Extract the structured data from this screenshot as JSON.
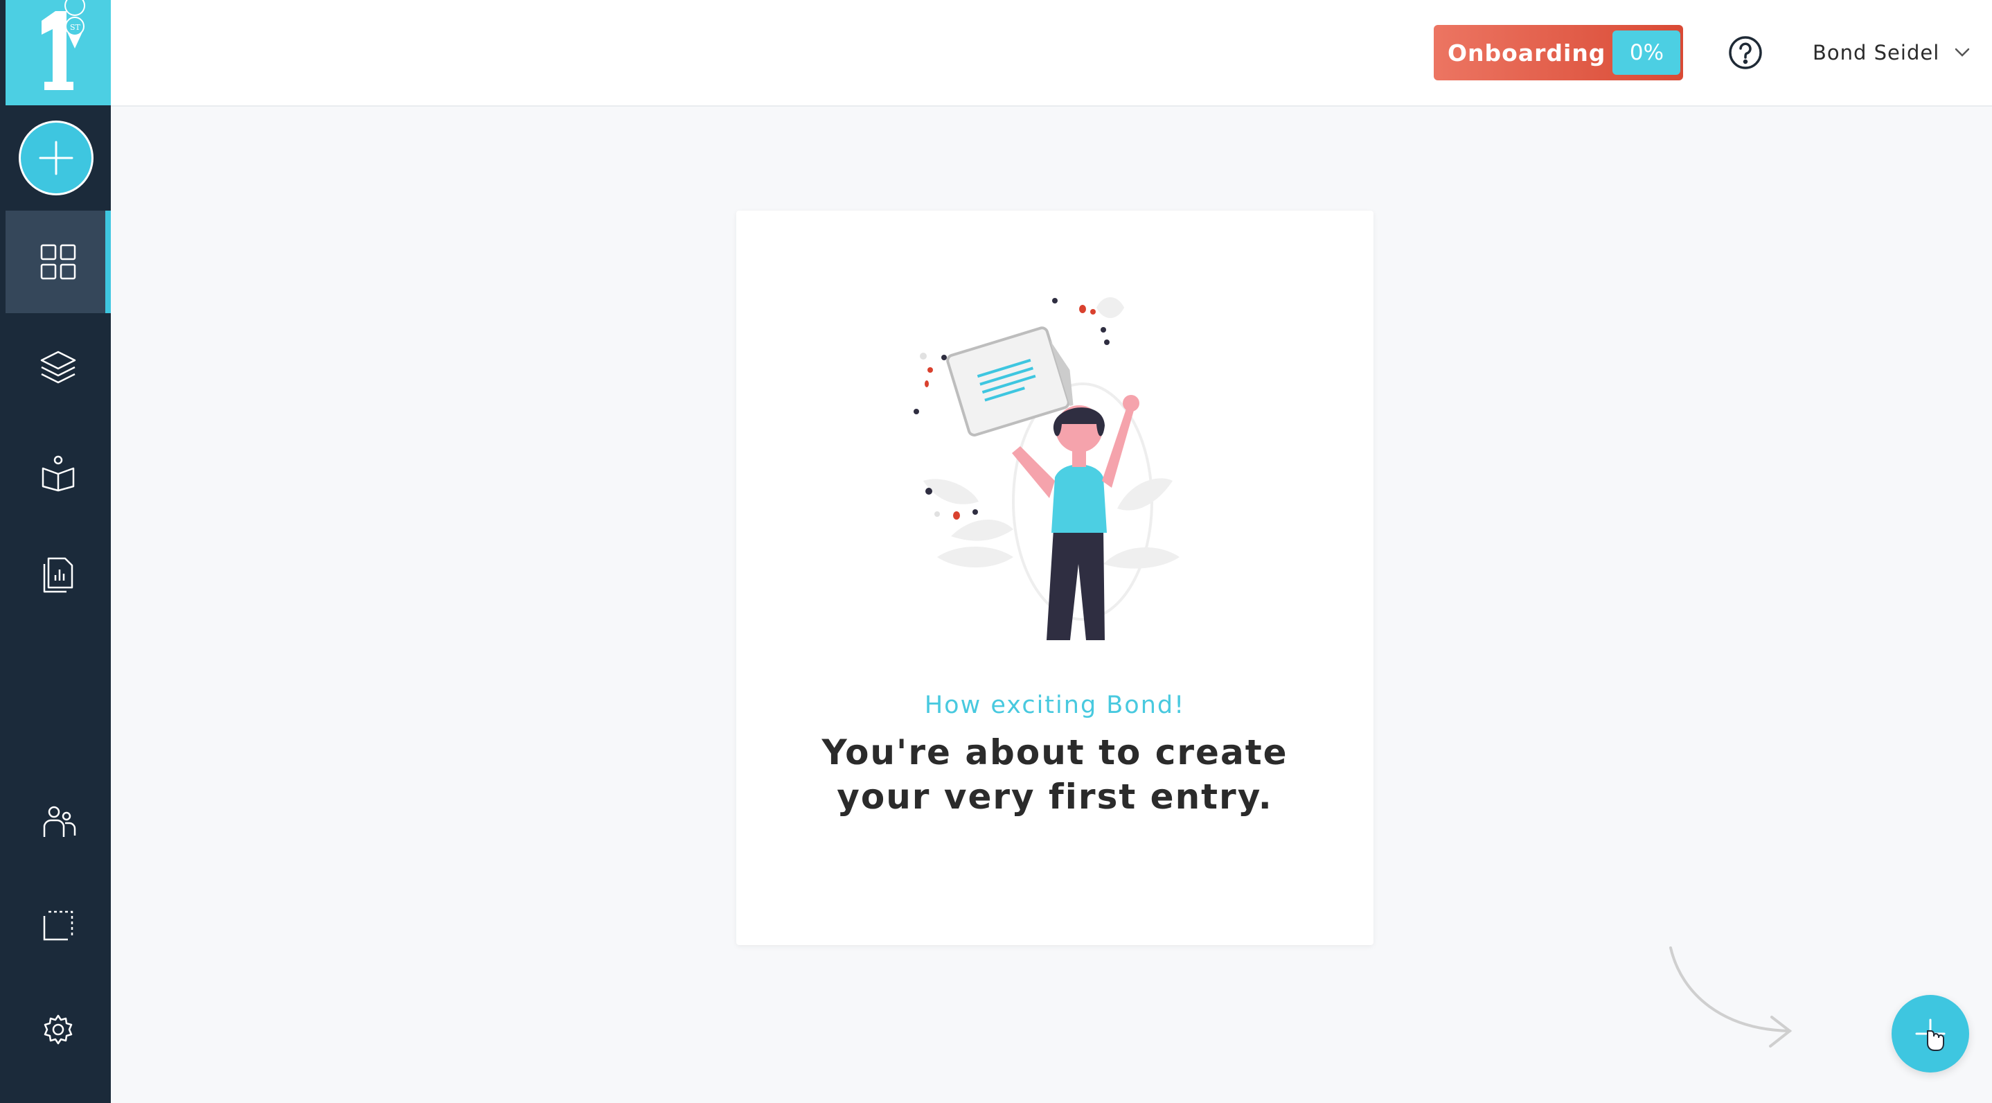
{
  "sidebar": {
    "logo_icon": "number-one-badge-logo",
    "new_button_icon": "plus-icon",
    "items": [
      {
        "icon": "dashboard-grid-icon",
        "active": true
      },
      {
        "icon": "layers-icon",
        "active": false
      },
      {
        "icon": "reader-book-icon",
        "active": false
      },
      {
        "icon": "report-document-icon",
        "active": false
      },
      {
        "icon": "users-icon",
        "active": false
      },
      {
        "icon": "crop-frame-icon",
        "active": false
      },
      {
        "icon": "gear-icon",
        "active": false
      }
    ]
  },
  "header": {
    "onboarding_label": "Onboarding",
    "onboarding_progress": "0%",
    "help_icon": "question-circle-icon",
    "user_name": "Bond Seidel",
    "user_menu_icon": "chevron-down-icon"
  },
  "card": {
    "subtitle": "How exciting Bond!",
    "heading_line1": "You're about to create",
    "heading_line2": "your very first entry."
  },
  "fab": {
    "icon": "plus-icon"
  },
  "colors": {
    "sidebar_bg": "#1b2a3a",
    "accent": "#3ec6e0",
    "onboarding_bg": "#e05b45",
    "heading_text": "#2b2b2b"
  }
}
